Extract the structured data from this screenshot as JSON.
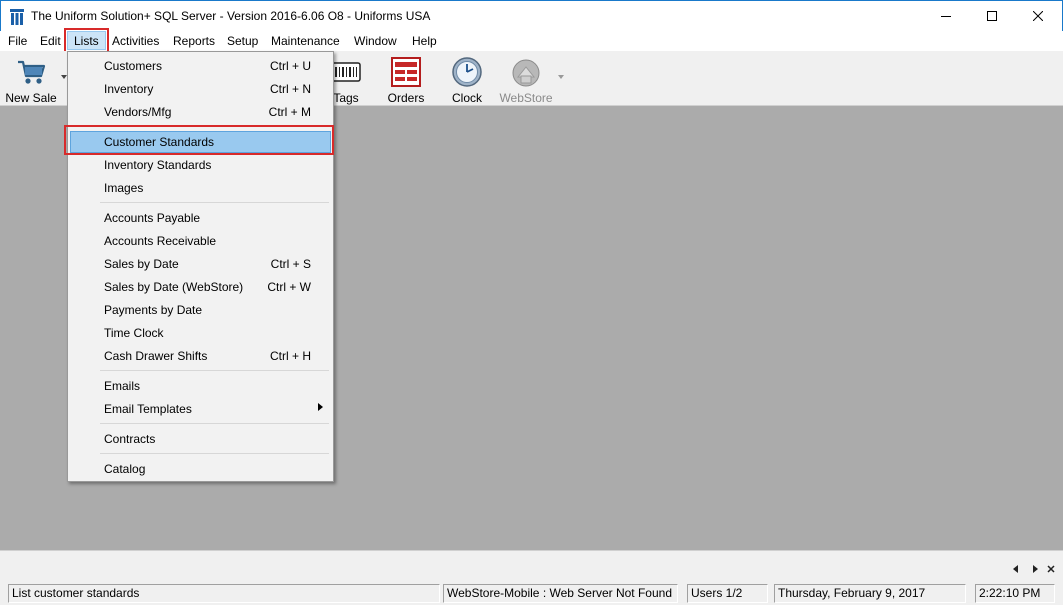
{
  "window": {
    "title": "The Uniform Solution+ SQL Server - Version 2016-6.06 O8 - Uniforms USA",
    "controls": [
      "minimize-icon",
      "maximize-icon",
      "close-icon"
    ]
  },
  "menubar": {
    "items": [
      "File",
      "Edit",
      "Lists",
      "Activities",
      "Reports",
      "Setup",
      "Maintenance",
      "Window",
      "Help"
    ],
    "active": "Lists"
  },
  "toolbar": {
    "new_sale": "New Sale",
    "tags": "Tags",
    "orders": "Orders",
    "clock": "Clock",
    "webstore": "WebStore"
  },
  "lists_menu": {
    "items": [
      {
        "label": "Customers",
        "shortcut": "Ctrl + U"
      },
      {
        "label": "Inventory",
        "shortcut": "Ctrl + N"
      },
      {
        "label": "Vendors/Mfg",
        "shortcut": "Ctrl + M"
      },
      {
        "label": "Customer Standards",
        "shortcut": ""
      },
      {
        "label": "Inventory Standards",
        "shortcut": ""
      },
      {
        "label": "Images",
        "shortcut": ""
      },
      {
        "label": "Accounts Payable",
        "shortcut": ""
      },
      {
        "label": "Accounts Receivable",
        "shortcut": ""
      },
      {
        "label": "Sales by Date",
        "shortcut": "Ctrl + S"
      },
      {
        "label": "Sales by Date (WebStore)",
        "shortcut": "Ctrl + W"
      },
      {
        "label": "Payments by Date",
        "shortcut": ""
      },
      {
        "label": "Time Clock",
        "shortcut": ""
      },
      {
        "label": "Cash Drawer Shifts",
        "shortcut": "Ctrl + H"
      },
      {
        "label": "Emails",
        "shortcut": ""
      },
      {
        "label": "Email Templates",
        "shortcut": ""
      },
      {
        "label": "Contracts",
        "shortcut": ""
      },
      {
        "label": "Catalog",
        "shortcut": ""
      }
    ],
    "highlighted": "Customer Standards"
  },
  "statusbar": {
    "message": "List customer standards",
    "webstore_status": "WebStore-Mobile : Web Server Not Found",
    "users": "Users 1/2",
    "date": "Thursday, February  9, 2017",
    "time": "2:22:10 PM"
  },
  "colors": {
    "highlight": "#99c9ef",
    "callout": "#d82a2a",
    "workspace": "#ababab"
  }
}
